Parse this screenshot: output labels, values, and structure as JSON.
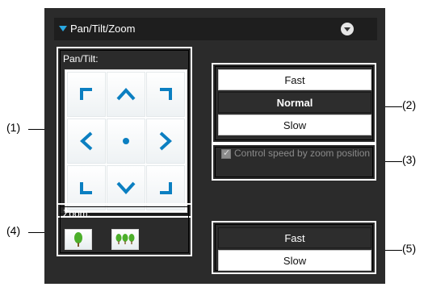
{
  "panel": {
    "title": "Pan/Tilt/Zoom",
    "collapse_icon": "chevron-down-icon"
  },
  "pan_tilt": {
    "label": "Pan/Tilt:",
    "buttons": [
      {
        "name": "up-left",
        "glyph": "⌜"
      },
      {
        "name": "up",
        "glyph": "︿"
      },
      {
        "name": "up-right",
        "glyph": "⌝"
      },
      {
        "name": "left",
        "glyph": "❮"
      },
      {
        "name": "home",
        "glyph": "●"
      },
      {
        "name": "right",
        "glyph": "❯"
      },
      {
        "name": "down-left",
        "glyph": "⌞"
      },
      {
        "name": "down",
        "glyph": "﹀"
      },
      {
        "name": "down-right",
        "glyph": "⌟"
      }
    ]
  },
  "pan_tilt_speed": {
    "options": [
      "Fast",
      "Normal",
      "Slow"
    ],
    "selected": "Normal"
  },
  "zoom_speed_checkbox": {
    "label": "Control speed by zoom position",
    "checked": true
  },
  "zoom": {
    "label": "Zoom:",
    "tele_icon": "single-tree-icon",
    "wide_icon": "three-trees-icon"
  },
  "zoom_speed": {
    "options": [
      "Fast",
      "Slow"
    ],
    "selected": "Fast"
  },
  "callouts": [
    "(1)",
    "(2)",
    "(3)",
    "(4)",
    "(5)"
  ],
  "colors": {
    "panel_bg": "#2b2b2b",
    "accent": "#0b7fc1",
    "tree_green": "#4caf2a"
  }
}
